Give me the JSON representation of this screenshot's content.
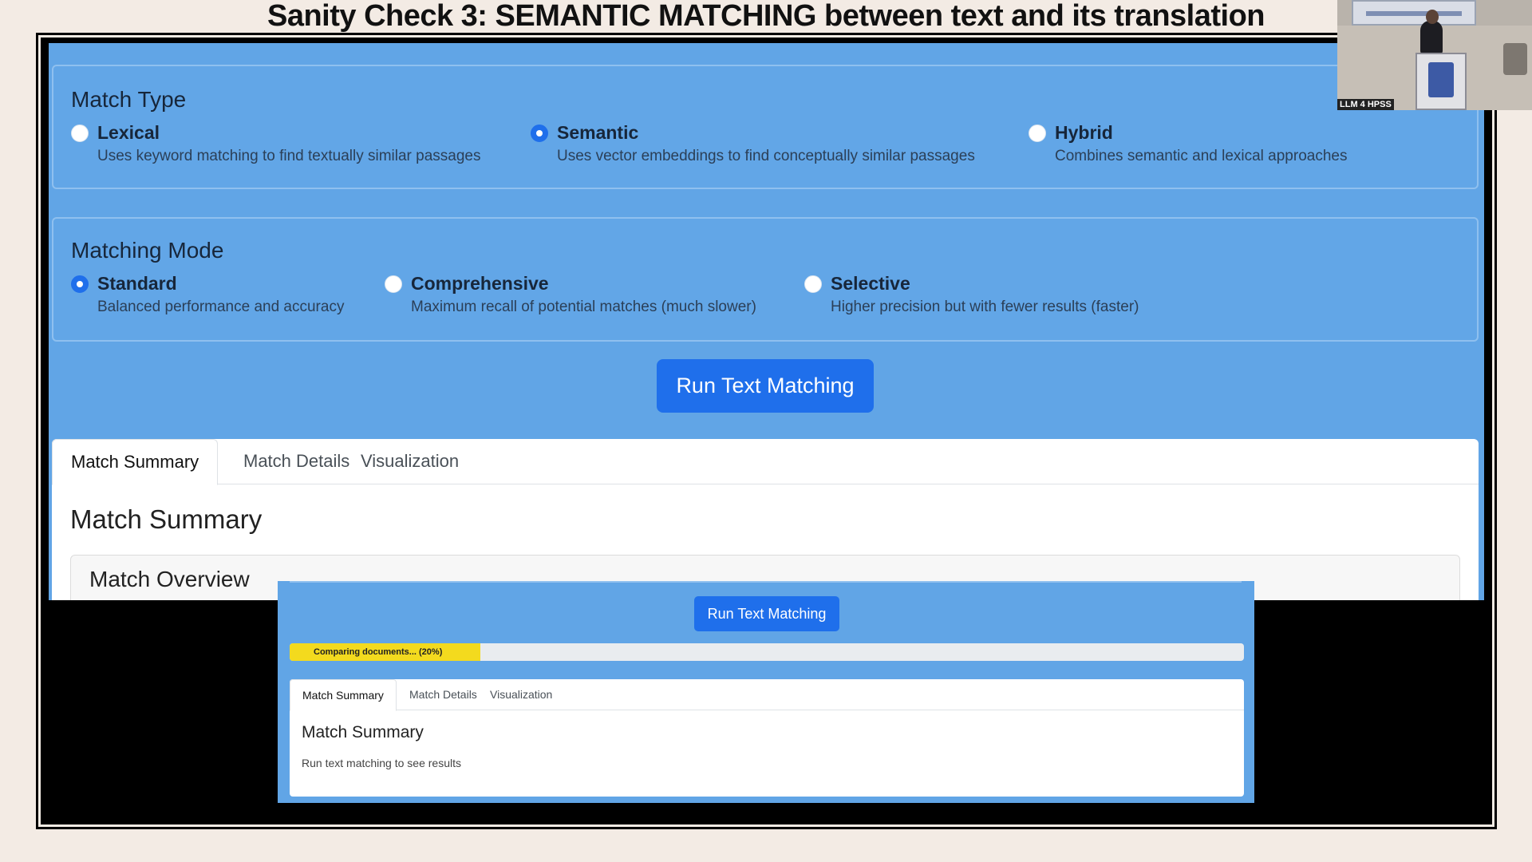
{
  "slide": {
    "title": "Sanity Check 3: SEMANTIC MATCHING between text and its translation"
  },
  "match_type": {
    "title": "Match Type",
    "options": [
      {
        "label": "Lexical",
        "desc": "Uses keyword matching to find textually similar passages",
        "checked": false
      },
      {
        "label": "Semantic",
        "desc": "Uses vector embeddings to find conceptually similar passages",
        "checked": true
      },
      {
        "label": "Hybrid",
        "desc": "Combines semantic and lexical approaches",
        "checked": false
      }
    ]
  },
  "matching_mode": {
    "title": "Matching Mode",
    "options": [
      {
        "label": "Standard",
        "desc": "Balanced performance and accuracy",
        "checked": true
      },
      {
        "label": "Comprehensive",
        "desc": "Maximum recall of potential matches (much slower)",
        "checked": false
      },
      {
        "label": "Selective",
        "desc": "Higher precision but with fewer results (faster)",
        "checked": false
      }
    ]
  },
  "run_button": "Run Text Matching",
  "results": {
    "tabs": [
      "Match Summary",
      "Match Details",
      "Visualization"
    ],
    "active_tab": "Match Summary",
    "heading": "Match Summary",
    "overview_title": "Match Overview"
  },
  "overlay": {
    "run_button": "Run Text Matching",
    "progress": {
      "label": "Comparing documents... (20%)",
      "percent": 20,
      "color": "#f3da1e"
    },
    "tabs": [
      "Match Summary",
      "Match Details",
      "Visualization"
    ],
    "heading": "Match Summary",
    "note": "Run text matching to see results"
  },
  "webcam": {
    "label": "LLM 4 HPSS"
  },
  "colors": {
    "panel_blue": "#61a5e6",
    "accent": "#1f6feb"
  }
}
